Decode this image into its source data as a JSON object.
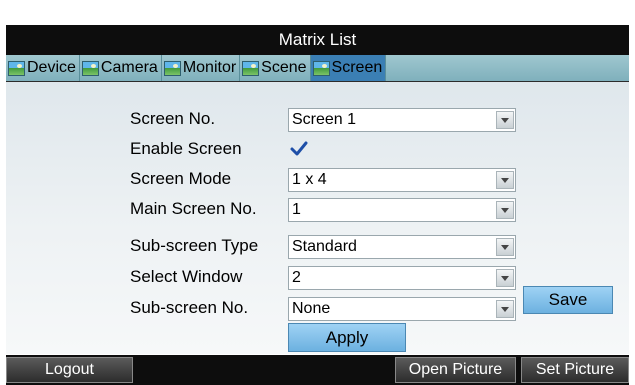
{
  "window": {
    "title": "Matrix List"
  },
  "tabs": [
    {
      "label": "Device",
      "icon": "picture-icon",
      "active": false
    },
    {
      "label": "Camera",
      "icon": "picture-icon",
      "active": false
    },
    {
      "label": "Monitor",
      "icon": "picture-icon",
      "active": false
    },
    {
      "label": "Scene",
      "icon": "picture-icon",
      "active": false
    },
    {
      "label": "Screen",
      "icon": "picture-icon",
      "active": true
    }
  ],
  "form": {
    "screen_no": {
      "label": "Screen No.",
      "value": "Screen 1"
    },
    "enable_screen": {
      "label": "Enable Screen",
      "checked": true
    },
    "screen_mode": {
      "label": "Screen Mode",
      "value": "1 x 4"
    },
    "main_screen_no": {
      "label": "Main Screen No.",
      "value": "1"
    },
    "sub_screen_type": {
      "label": "Sub-screen Type",
      "value": "Standard"
    },
    "select_window": {
      "label": "Select Window",
      "value": "2"
    },
    "sub_screen_no": {
      "label": "Sub-screen No.",
      "value": "None"
    },
    "save_label": "Save",
    "apply_label": "Apply"
  },
  "footer": {
    "logout_label": "Logout",
    "open_picture_label": "Open Picture",
    "set_picture_label": "Set Picture"
  },
  "colors": {
    "title_bar": "#0d0d0d",
    "tab_bar": "#8fbcc6",
    "tab_active": "#3b7fb4",
    "button": "#8cc6ec",
    "checkmark": "#1e4fa8"
  }
}
